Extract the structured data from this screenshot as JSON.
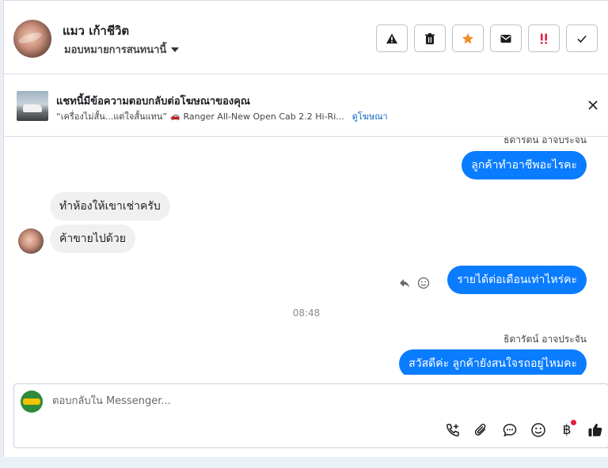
{
  "contact": {
    "name": "แมว เก้าชีวิต",
    "assign_label": "มอบหมายการสนทนานี้"
  },
  "actions": [
    {
      "name": "report-spam",
      "icon": "warning-icon"
    },
    {
      "name": "delete",
      "icon": "trash-icon"
    },
    {
      "name": "star",
      "icon": "star-icon",
      "color": "#f28c28"
    },
    {
      "name": "mark-unread",
      "icon": "envelope-icon"
    },
    {
      "name": "follow-up",
      "icon": "exclamation-icon",
      "color": "#e41e3f"
    },
    {
      "name": "mark-done",
      "icon": "check-icon"
    }
  ],
  "ad": {
    "title": "แชทนี้มีข้อความตอบกลับต่อโฆษณาของคุณ",
    "quote": "“เครื่องไม่สั้น...แต่ใจสั้นแทน”",
    "car_icon": "car-icon",
    "product": "Ranger All-New Open Cab 2.2 Hi-Ri...",
    "link": "ดูโฆษณา"
  },
  "messages": {
    "sender_top_partial": "ธิดารัตน์ อาจประจัน",
    "out_1": "ลูกค้าทำอาชีพอะไรคะ",
    "in_1": "ทำห้องให้เขาเช่าครับ",
    "in_2": "ค้าขายไปด้วย",
    "out_2": "รายได้ต่อเดือนเท่าไหร่คะ",
    "timestamp": "08:48",
    "sender_name": "ธิดารัตน์ อาจประจัน",
    "out_3": "สวัสดีค่ะ ลูกค้ายังสนใจรถอยู่ไหมคะ"
  },
  "composer": {
    "placeholder": "ตอบกลับใน Messenger...",
    "baht_symbol": "฿",
    "tools": [
      "call-add-icon",
      "paperclip-icon",
      "chat-bubble-icon",
      "emoji-icon",
      "baht-icon",
      "thumbs-up-icon"
    ]
  },
  "colors": {
    "accent": "#0a7cff",
    "incoming_bubble": "#f0f0f0",
    "link": "#0a66c2"
  }
}
